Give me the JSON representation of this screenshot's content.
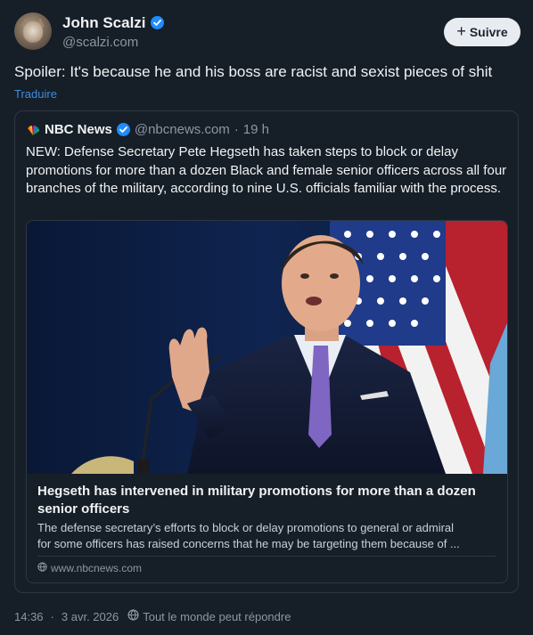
{
  "author": {
    "name": "John Scalzi",
    "handle": "@scalzi.com",
    "verified_color": "#1d8cff"
  },
  "follow": {
    "label": "Suivre",
    "icon": "plus-icon"
  },
  "post": {
    "text": "Spoiler: It's because he and his boss are racist and sexist pieces of shit",
    "translate_label": "Traduire"
  },
  "quoted": {
    "name": "NBC News",
    "handle": "@nbcnews.com",
    "separator": "·",
    "age": "19 h",
    "text": "NEW: Defense Secretary Pete Hegseth has taken steps to block or delay promotions for more than a dozen Black and female senior officers across all four branches of the military, according to nine U.S. officials familiar with the process.",
    "card": {
      "title": "Hegseth has intervened in military promotions for more than a dozen senior officers",
      "desc_line1": "The defense secretary’s efforts to block or delay promotions to general or admiral",
      "desc_line2": "for some officers has raised concerns that he may be targeting them because of ...",
      "domain": "www.nbcnews.com"
    }
  },
  "footer": {
    "time": "14:36",
    "separator": "·",
    "date": "3 avr. 2026",
    "reply_setting": "Tout le monde peut répondre"
  },
  "colors": {
    "background": "#161e27",
    "link": "#3d8fe0",
    "muted": "#8c97a4",
    "border": "#2d3845"
  }
}
